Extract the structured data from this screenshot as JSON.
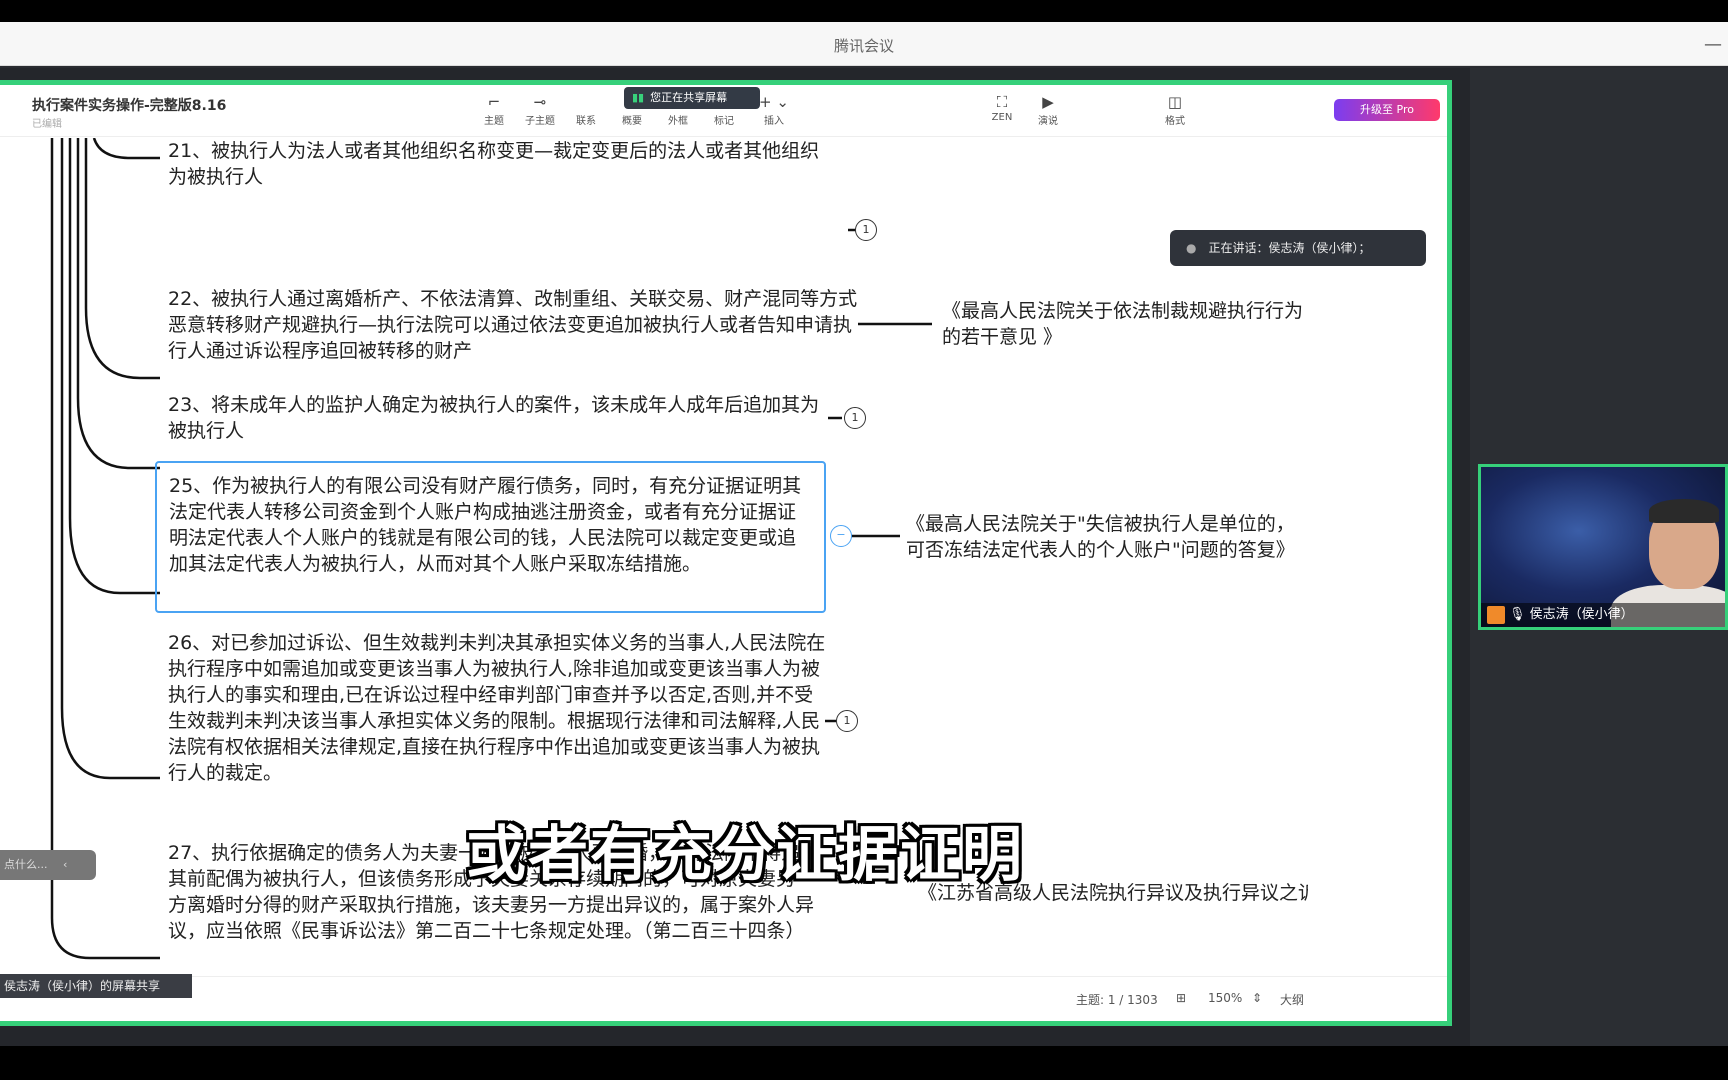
{
  "meeting": {
    "title": "腾讯会议",
    "speaking": "正在讲话：侯志涛（侯小律）；",
    "participant_name": "侯志涛（侯小律）",
    "share_owner": "侯志涛（侯小律）的屏幕共享",
    "sharing_label": "您正在共享屏幕"
  },
  "app": {
    "doc_title": "执行案件实务操作-完整版8.16",
    "doc_status": "已编辑",
    "tools": [
      {
        "icon": "topic-icon",
        "label": "主题"
      },
      {
        "icon": "subtopic-icon",
        "label": "子主题"
      },
      {
        "icon": "relation-icon",
        "label": "联系"
      },
      {
        "icon": "summary-icon",
        "label": "概要"
      },
      {
        "icon": "boundary-icon",
        "label": "外框"
      },
      {
        "icon": "marker-icon",
        "label": "标记"
      },
      {
        "icon": "insert-icon",
        "label": "插入"
      },
      {
        "icon": "zen-icon",
        "label": "ZEN"
      },
      {
        "icon": "present-icon",
        "label": "演说"
      },
      {
        "icon": "format-icon",
        "label": "格式"
      }
    ],
    "upgrade_label": "升级至 Pro",
    "left_chip": "点什么...",
    "status": {
      "topic_count": "主题: 1 / 1303",
      "zoom": "150%",
      "outline": "大纲"
    }
  },
  "nodes": {
    "n21": "21、被执行人为法人或者其他组织名称变更—裁定变更后的法人或者其他组织为被执行人",
    "n22": "22、被执行人通过离婚析产、不依法清算、改制重组、关联交易、财产混同等方式恶意转移财产规避执行—执行法院可以通过依法变更追加被执行人或者告知申请执行人通过诉讼程序追回被转移的财产",
    "n23": "23、将未成年人的监护人确定为被执行人的案件，该未成年人成年后追加其为被执行人",
    "n25": "25、作为被执行人的有限公司没有财产履行债务，同时，有充分证据证明其法定代表人转移公司资金到个人账户构成抽逃注册资金，或者有充分证据证明法定代表人个人账户的钱就是有限公司的钱，人民法院可以裁定变更或追加其法定代表人为被执行人，从而对其个人账户采取冻结措施。",
    "n26": "26、对已参加过诉讼、但生效裁判未判决其承担实体义务的当事人,人民法院在执行程序中如需追加或变更该当事人为被执行人,除非追加或变更该当事人为被执行人的事实和理由,已在诉讼过程中经审判部门审查并予以否定,否则,并不受生效裁判未判决该当事人承担实体义务的限制。根据现行法律和司法解释,人民法院有权依据相关法律规定,直接在执行程序中作出追加或变更该当事人为被执行人的裁定。",
    "n27": "27、执行依据确定的债务人为夫妻一方，被执行人已离婚，执行法院不得追加其前配偶为被执行人，但该债务形成于夫妻关系存续期间的，可对原夫妻另一方离婚时分得的财产采取执行措施，该夫妻另一方提出异议的，属于案外人异议，应当依照《民事诉讼法》第二百二十七条规定处理。（第二百三十四条）",
    "badge": "1"
  },
  "refs": {
    "r22": "《最高人民法院关于依法制裁规避执行行为的若干意见 》",
    "r25": "《最高人民法院关于\"失信被执行人是单位的，可否冻结法定代表人的个人账户\"问题的答复》",
    "r27": "《江苏省高级人民法院执行异议及执行异议之诉案件审理指南》"
  },
  "subtitle": "或者有充分证据证明"
}
